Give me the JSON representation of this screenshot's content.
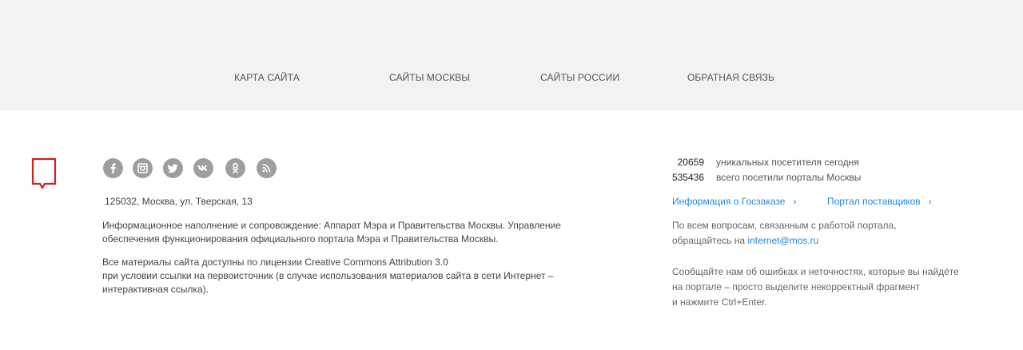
{
  "nav": {
    "sitemap": "КАРТА САЙТА",
    "moscow_sites": "САЙТЫ МОСКВЫ",
    "russia_sites": "САЙТЫ РОССИИ",
    "feedback": "ОБРАТНАЯ СВЯЗЬ"
  },
  "colors": {
    "band_bg": "#f2f2f2",
    "logo_red": "#cc2222",
    "link_blue": "#1e88e5",
    "social_gray": "#9e9e9e"
  },
  "social": [
    "facebook-icon",
    "instagram-icon",
    "twitter-icon",
    "vk-icon",
    "odnoklassniki-icon",
    "rss-icon"
  ],
  "address": "125032, Москва, ул. Тверская, 13",
  "info": {
    "line1": "Информационное наполнение и сопровождение: Аппарат Мэра и Правительства Москвы. Управление",
    "line2": "обеспечения функционирования официального портала Мэра и Правительства Москвы."
  },
  "license": {
    "line1": "Все материалы сайта доступны по лицензии Creative Commons Attribution 3.0",
    "line2": "при условии ссылки на первоисточник (в случае использования материалов сайта в сети Интернет –",
    "line3": "интерактивная ссылка)."
  },
  "stats": {
    "today_count": "20659",
    "today_label": "уникальных посетителя сегодня",
    "total_count": "535436",
    "total_label": "всего посетили порталы Москвы"
  },
  "links": {
    "goszakaz": "Информация о Госзаказе",
    "suppliers": "Портал поставщиков"
  },
  "contact": {
    "line1": "По всем вопросам, связанным с работой портала,",
    "line2_prefix": "обращайтесь на",
    "email": "internet@mos.ru"
  },
  "report": {
    "line1": "Сообщайте нам об ошибках и неточностях, которые вы найдёте",
    "line2": "на портале – просто выделите некорректный фрагмент",
    "line3": "и нажмите Ctrl+Enter."
  }
}
